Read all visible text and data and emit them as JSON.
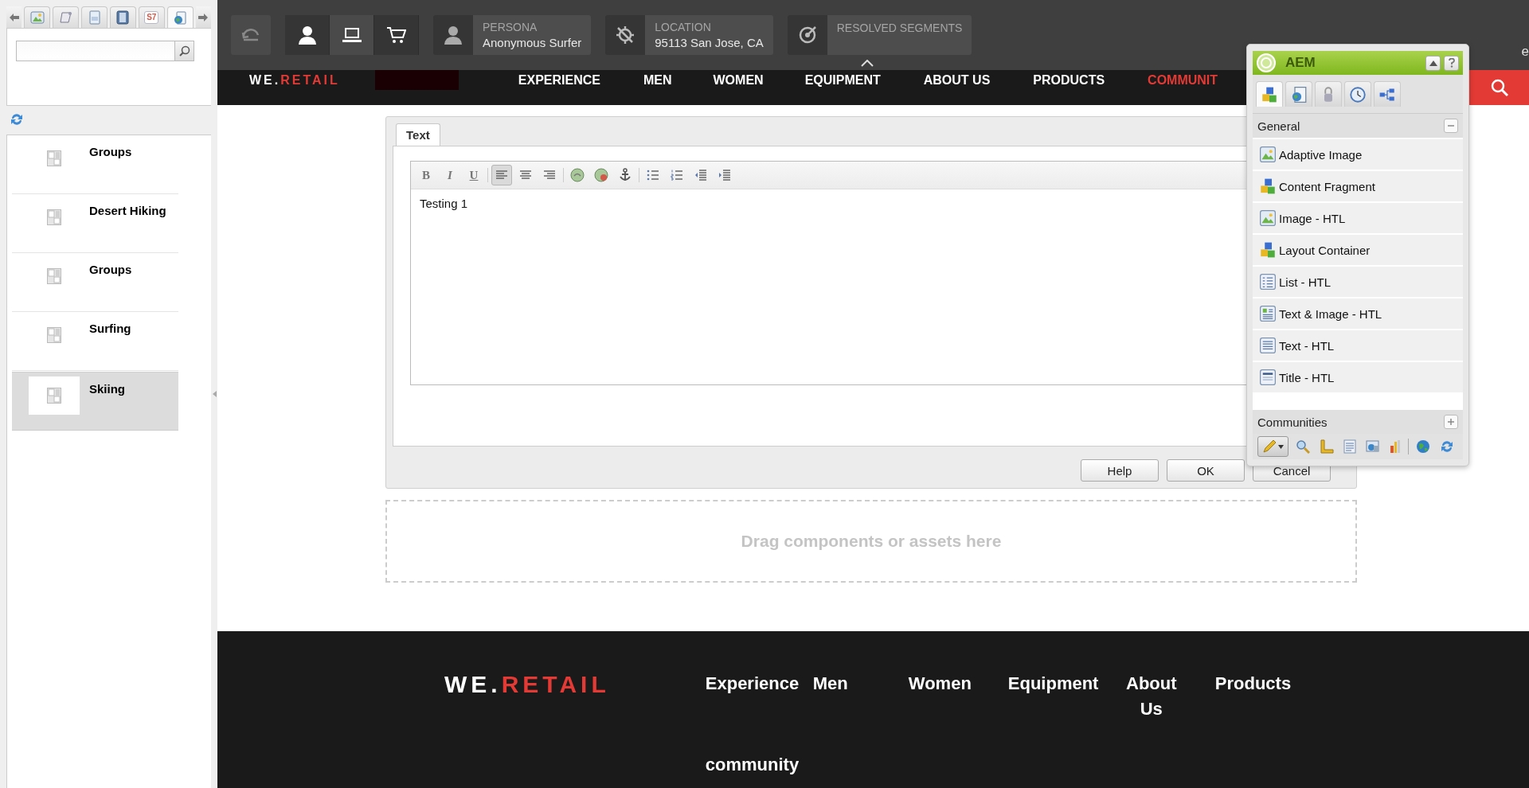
{
  "sidebar": {
    "tabs": [
      {
        "kind": "image",
        "selected": false
      },
      {
        "kind": "scroll",
        "selected": false
      },
      {
        "kind": "page",
        "selected": false
      },
      {
        "kind": "film",
        "selected": false
      },
      {
        "kind": "badge",
        "label": "S7",
        "selected": false
      },
      {
        "kind": "globe",
        "selected": true
      }
    ],
    "items": [
      {
        "title": "Groups",
        "selected": false
      },
      {
        "title": "Desert Hiking",
        "selected": false
      },
      {
        "title": "Groups",
        "selected": false
      },
      {
        "title": "Surfing",
        "selected": false
      },
      {
        "title": "Skiing",
        "selected": true
      }
    ]
  },
  "toolbar": {
    "devices": [
      {
        "kind": "person",
        "selected": false
      },
      {
        "kind": "laptop",
        "selected": true
      },
      {
        "kind": "cart",
        "selected": false
      }
    ],
    "persona": {
      "label": "PERSONA",
      "value": "Anonymous Surfer"
    },
    "location": {
      "label": "LOCATION",
      "value": "95113 San Jose, CA"
    },
    "segments": {
      "label": "RESOLVED SEGMENTS"
    }
  },
  "site_nav": {
    "logo": {
      "prefix": "WE.",
      "accent": "RETAIL"
    },
    "items": [
      {
        "label": "EXPERIENCE",
        "active": false
      },
      {
        "label": "MEN",
        "active": false
      },
      {
        "label": "WOMEN",
        "active": false
      },
      {
        "label": "EQUIPMENT",
        "active": false
      },
      {
        "label": "ABOUT US",
        "active": false
      },
      {
        "label": "PRODUCTS",
        "active": false
      },
      {
        "label": "COMMUNIT",
        "active": true
      }
    ]
  },
  "dialog": {
    "tabs": [
      {
        "label": "Text",
        "selected": true
      }
    ],
    "format_buttons": [
      {
        "kind": "bold",
        "label": "B",
        "selected": false
      },
      {
        "kind": "italic",
        "label": "I",
        "selected": false
      },
      {
        "kind": "underline",
        "label": "U",
        "selected": false
      },
      {
        "kind": "align-left",
        "selected": true
      },
      {
        "kind": "align-center",
        "selected": false
      },
      {
        "kind": "align-right",
        "selected": false
      },
      {
        "kind": "link",
        "selected": false
      },
      {
        "kind": "unlink",
        "selected": false
      },
      {
        "kind": "anchor",
        "selected": false
      },
      {
        "kind": "bullets",
        "selected": false
      },
      {
        "kind": "numbers",
        "selected": false
      },
      {
        "kind": "outdent",
        "selected": false
      },
      {
        "kind": "indent",
        "selected": false
      }
    ],
    "content": "Testing 1",
    "buttons": [
      "Help",
      "OK",
      "Cancel"
    ]
  },
  "drop_zone": {
    "text": "Drag components or assets here"
  },
  "sidekick": {
    "title": "AEM",
    "tabs": [
      {
        "kind": "components",
        "selected": true
      },
      {
        "kind": "page",
        "selected": false
      },
      {
        "kind": "lock",
        "selected": false
      },
      {
        "kind": "clock",
        "selected": false
      },
      {
        "kind": "tree",
        "selected": false
      }
    ],
    "groups": [
      {
        "title": "General",
        "expanded": true,
        "items": [
          {
            "label": "Adaptive Image",
            "kind": "image"
          },
          {
            "label": "Content Fragment",
            "kind": "cubes"
          },
          {
            "label": "Image - HTL",
            "kind": "image"
          },
          {
            "label": "Layout Container",
            "kind": "cubes"
          },
          {
            "label": "List - HTL",
            "kind": "list"
          },
          {
            "label": "Text & Image - HTL",
            "kind": "textimage"
          },
          {
            "label": "Text - HTL",
            "kind": "text"
          },
          {
            "label": "Title - HTL",
            "kind": "title"
          }
        ]
      },
      {
        "title": "Communities",
        "expanded": false
      }
    ],
    "tools": [
      {
        "kind": "pencil",
        "selected": true
      },
      {
        "kind": "magnifier",
        "selected": false
      },
      {
        "kind": "ruler",
        "selected": false
      },
      {
        "kind": "document",
        "selected": false
      },
      {
        "kind": "screen",
        "selected": false
      },
      {
        "kind": "bars",
        "selected": false
      },
      {
        "kind": "globe",
        "selected": false
      },
      {
        "kind": "refresh",
        "selected": false
      }
    ]
  },
  "footer": {
    "logo": {
      "prefix": "WE.",
      "accent": "RETAIL"
    },
    "links": [
      "Experience",
      "Men",
      "Women",
      "Equipment",
      "About Us",
      "Products",
      "community"
    ]
  },
  "edge_text": "e"
}
